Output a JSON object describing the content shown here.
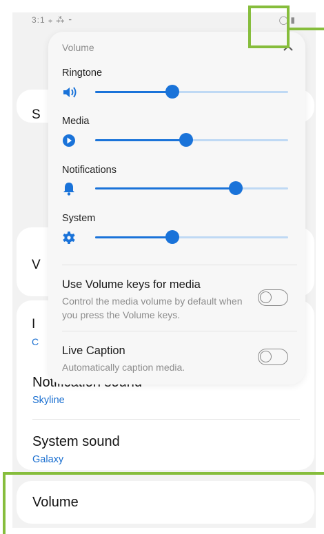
{
  "volume_panel": {
    "title": "Volume",
    "sliders": [
      {
        "label": "Ringtone",
        "icon": "speaker-icon",
        "level": 0.4
      },
      {
        "label": "Media",
        "icon": "play-icon",
        "level": 0.47
      },
      {
        "label": "Notifications",
        "icon": "bell-icon",
        "level": 0.73
      },
      {
        "label": "System",
        "icon": "gear-icon",
        "level": 0.4
      }
    ],
    "toggles": [
      {
        "title": "Use Volume keys for media",
        "description": "Control the media volume by default when you press the Volume keys.",
        "on": false
      },
      {
        "title": "Live Caption",
        "description": "Automatically caption media.",
        "on": false
      }
    ]
  },
  "settings": {
    "notification_sound": {
      "title": "Notification sound",
      "value": "Skyline"
    },
    "system_sound": {
      "title": "System sound",
      "value": "Galaxy"
    },
    "volume": {
      "title": "Volume"
    }
  },
  "colors": {
    "accent": "#1a73d9",
    "track": "#bfd9f4",
    "highlight": "#86bd3c",
    "link": "#1a6fd0"
  }
}
